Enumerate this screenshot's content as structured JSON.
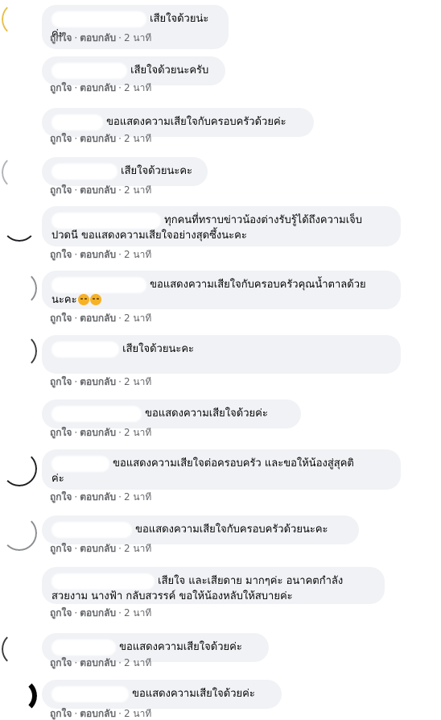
{
  "meta": {
    "like": "ถูกใจ",
    "reply": "ตอบกลับ",
    "time": "2 นาที",
    "dot": "·"
  },
  "comments": [
    {
      "text": "เสียใจด้วยน่ะค่ะ"
    },
    {
      "text": "เสียใจด้วยนะครับ"
    },
    {
      "text": "ขอแสดงความเสียใจกับครอบครัวด้วยค่ะ"
    },
    {
      "text": "เสียใจด้วยนะคะ"
    },
    {
      "line1": "ทุกคนที่ทราบข่าวน้องต่างรับรู้ได้ถึงความเจ็บ",
      "line2": "ปวดนี ขอแสดงความเสียใจอย่างสุดซึ้งนะคะ"
    },
    {
      "line1": "ขอแสดงความเสียใจกับครอบครัวคุณน้ำตาลด้วย",
      "line2": "นะคะ"
    },
    {
      "text": "เสียใจด้วยนะคะ"
    },
    {
      "text": "ขอแสดงความเสียใจด้วยค่ะ"
    },
    {
      "line1": "ขอแสดงความเสียใจต่อครอบครัว และขอให้น้องสู่สุคติ",
      "line2": "ค่ะ"
    },
    {
      "text": "ขอแสดงความเสียใจกับครอบครัวด้วยนะคะ"
    },
    {
      "line1": "เสียใจ และเสียดาย มากๆค่ะ อนาคตกำลัง",
      "line2": "สวยงาม นางฟ้า กลับสวรรค์ ขอให้น้องหลับให้สบายค่ะ"
    },
    {
      "text": "ขอแสดงความเสียใจด้วยค่ะ"
    },
    {
      "text": "ขอแสดงความเสียใจด้วยค่ะ"
    }
  ]
}
